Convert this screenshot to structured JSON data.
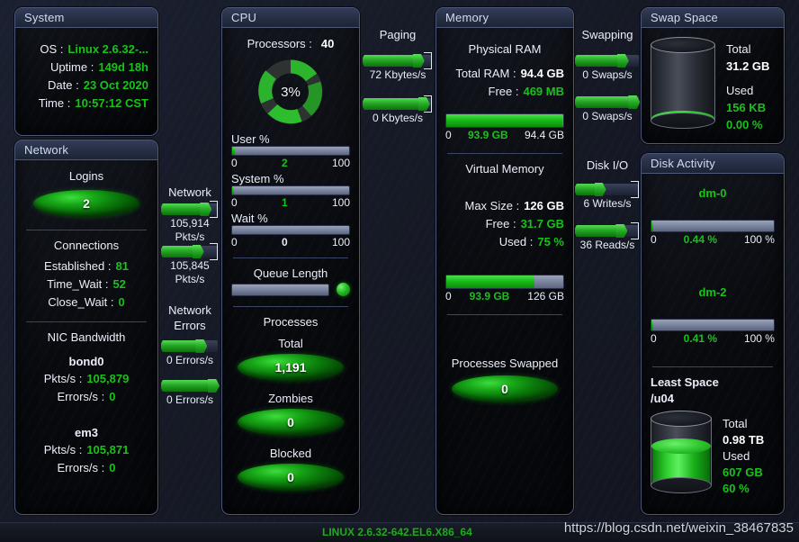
{
  "system": {
    "title": "System",
    "rows": [
      {
        "label": "OS :",
        "value": "Linux  2.6.32-...",
        "color": "green"
      },
      {
        "label": "Uptime :",
        "value": "149d 18h",
        "color": "green"
      },
      {
        "label": "Date :",
        "value": "23 Oct 2020",
        "color": "green"
      },
      {
        "label": "Time :",
        "value": "10:57:12 CST",
        "color": "green"
      }
    ]
  },
  "network": {
    "title": "Network",
    "logins_header": "Logins",
    "logins_value": "2",
    "connections_header": "Connections",
    "connections": [
      {
        "label": "Established :",
        "value": "81"
      },
      {
        "label": "Time_Wait :",
        "value": "52"
      },
      {
        "label": "Close_Wait :",
        "value": "0"
      }
    ],
    "nic_header": "NIC Bandwidth",
    "nics": [
      {
        "name": "bond0",
        "rows": [
          {
            "label": "Pkts/s :",
            "value": "105,879"
          },
          {
            "label": "Errors/s :",
            "value": "0"
          }
        ]
      },
      {
        "name": "em3",
        "rows": [
          {
            "label": "Pkts/s :",
            "value": "105,871"
          },
          {
            "label": "Errors/s :",
            "value": "0"
          }
        ]
      }
    ]
  },
  "network_gauges": {
    "header": "Network",
    "items": [
      {
        "label": "105,914\nPkts/s",
        "fill_pct": 78,
        "knob_pct": 78
      },
      {
        "label": "105,845\nPkts/s",
        "fill_pct": 64,
        "knob_pct": 64
      }
    ],
    "errors_header": "Network\nErrors",
    "error_items": [
      {
        "label": "0 Errors/s",
        "fill_pct": 70,
        "knob_pct": 70
      },
      {
        "label": "0 Errors/s",
        "fill_pct": 92,
        "knob_pct": 92
      }
    ]
  },
  "cpu": {
    "title": "CPU",
    "processors_label": "Processors :",
    "processors_value": "40",
    "donut_value": "3%",
    "bars": [
      {
        "label": "User %",
        "min": "0",
        "mid": "2",
        "max": "100",
        "fill_pct": 2
      },
      {
        "label": "System %",
        "min": "0",
        "mid": "1",
        "max": "100",
        "fill_pct": 1
      },
      {
        "label": "Wait %",
        "min": "0",
        "mid": "0",
        "max": "100",
        "fill_pct": 0
      }
    ],
    "queue_header": "Queue Length",
    "queue_fill_pct": 0,
    "processes_header": "Processes",
    "processes": [
      {
        "label": "Total",
        "value": "1,191"
      },
      {
        "label": "Zombies",
        "value": "0"
      },
      {
        "label": "Blocked",
        "value": "0"
      }
    ]
  },
  "paging": {
    "header": "Paging",
    "items": [
      {
        "label": "72 Kbytes/s",
        "fill_pct": 80,
        "knob_pct": 80
      },
      {
        "label": "0 Kbytes/s",
        "fill_pct": 88,
        "knob_pct": 88
      }
    ]
  },
  "memory": {
    "title": "Memory",
    "physical_header": "Physical RAM",
    "physical_rows": [
      {
        "label": "Total RAM :",
        "value": "94.4 GB",
        "color": "white"
      },
      {
        "label": "Free :",
        "value": "469 MB",
        "color": "green"
      }
    ],
    "physical_bar": {
      "min": "0",
      "mid": "93.9 GB",
      "max": "94.4 GB",
      "fill_pct": 99.5
    },
    "virtual_header": "Virtual Memory",
    "virtual_rows": [
      {
        "label": "Max Size :",
        "value": "126 GB",
        "color": "white"
      },
      {
        "label": "Free :",
        "value": "31.7 GB",
        "color": "green"
      },
      {
        "label": "Used :",
        "value": "75 %",
        "color": "green"
      }
    ],
    "virtual_bar": {
      "min": "0",
      "mid": "93.9 GB",
      "max": "126 GB",
      "fill_pct": 75
    },
    "swapped_header": "Processes Swapped",
    "swapped_value": "0"
  },
  "swapping_gauges": {
    "header": "Swapping",
    "items": [
      {
        "label": "0 Swaps/s",
        "fill_pct": 74,
        "knob_pct": 74
      },
      {
        "label": "0 Swaps/s",
        "fill_pct": 92,
        "knob_pct": 92
      }
    ],
    "disk_header": "Disk I/O",
    "disk_items": [
      {
        "label": "6 Writes/s",
        "fill_pct": 38,
        "knob_pct": 38
      },
      {
        "label": "36 Reads/s",
        "fill_pct": 72,
        "knob_pct": 72
      }
    ]
  },
  "swap_space": {
    "title": "Swap Space",
    "total_label": "Total",
    "total_value": "31.2 GB",
    "used_label": "Used",
    "used_value": "156 KB",
    "used_pct_value": "0.00 %",
    "fill_pct": 3
  },
  "disk_activity": {
    "title": "Disk Activity",
    "disks": [
      {
        "name": "dm-0",
        "min": "0",
        "mid": "0.44 %",
        "max": "100 %",
        "fill_pct": 1.5
      },
      {
        "name": "dm-2",
        "min": "0",
        "mid": "0.41 %",
        "max": "100 %",
        "fill_pct": 1.5
      }
    ],
    "least_space_header": "Least Space",
    "least_space_mount": "/u04",
    "total_label": "Total",
    "total_value": "0.98 TB",
    "used_label": "Used",
    "used_value": "607 GB",
    "used_pct_value": "60 %",
    "fill_pct": 60
  },
  "statusbar": {
    "os_version": "LINUX 2.6.32-642.EL6.X86_64",
    "watermark": "https://blog.csdn.net/weixin_38467835"
  },
  "colors": {
    "green": "#19c219",
    "white": "#ffffff",
    "panel_border": "#4e5878",
    "title_text": "#d2dcf0"
  }
}
